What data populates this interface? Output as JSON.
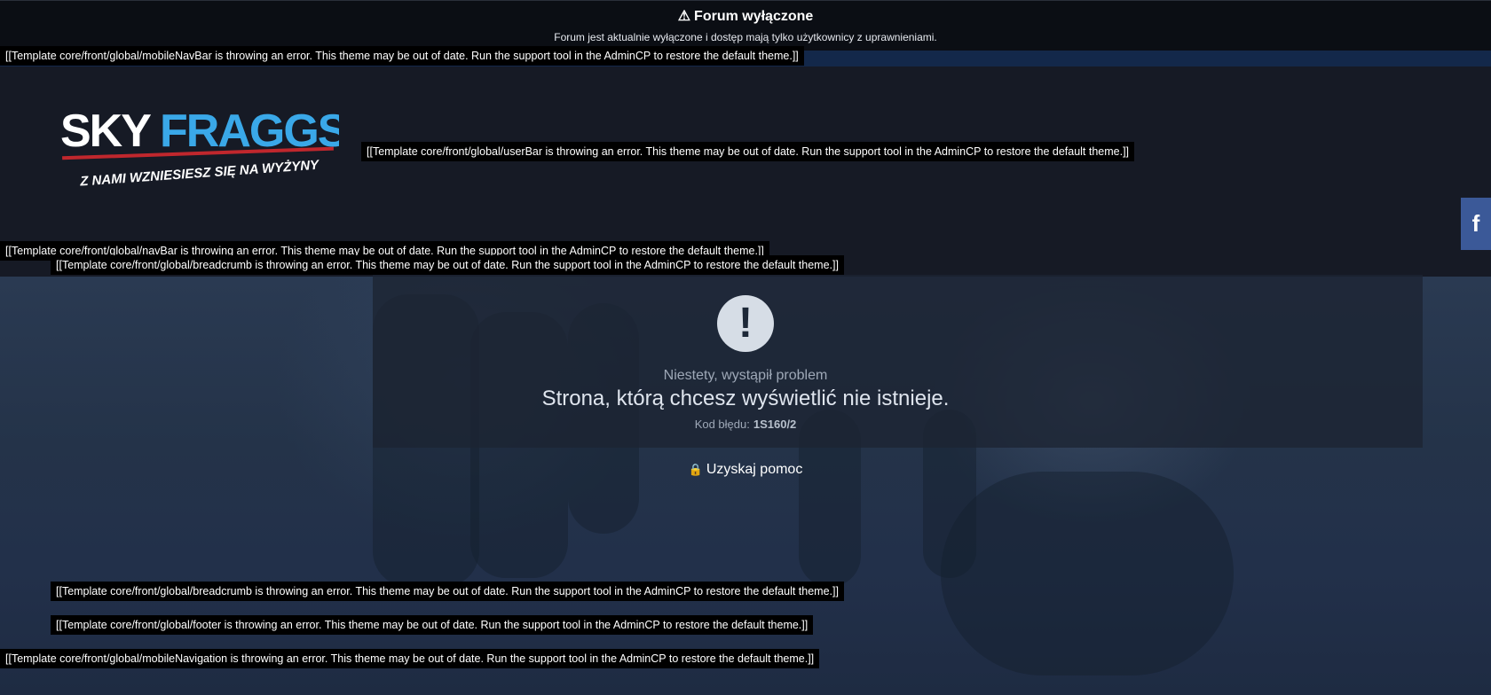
{
  "offline": {
    "icon": "warning-icon",
    "title": "Forum wyłączone",
    "message": "Forum jest aktualnie wyłączone i dostęp mają tylko użytkownicy z uprawnieniami."
  },
  "template_errors": {
    "mobile_nav_bar": "[[Template core/front/global/mobileNavBar is throwing an error. This theme may be out of date. Run the support tool in the AdminCP to restore the default theme.]]",
    "user_bar": "[[Template core/front/global/userBar is throwing an error. This theme may be out of date. Run the support tool in the AdminCP to restore the default theme.]]",
    "nav_bar": "[[Template core/front/global/navBar is throwing an error. This theme may be out of date. Run the support tool in the AdminCP to restore the default theme.]]",
    "breadcrumb_top": "[[Template core/front/global/breadcrumb is throwing an error. This theme may be out of date. Run the support tool in the AdminCP to restore the default theme.]]",
    "breadcrumb_bottom": "[[Template core/front/global/breadcrumb is throwing an error. This theme may be out of date. Run the support tool in the AdminCP to restore the default theme.]]",
    "footer": "[[Template core/front/global/footer is throwing an error. This theme may be out of date. Run the support tool in the AdminCP to restore the default theme.]]",
    "mobile_navigation": "[[Template core/front/global/mobileNavigation is throwing an error. This theme may be out of date. Run the support tool in the AdminCP to restore the default theme.]]"
  },
  "logo": {
    "name_part1": "SKY",
    "name_part2": "FRAGGS",
    "tagline": "Z NAMI WZNIESIESZ SIĘ NA WYŻYNY"
  },
  "error": {
    "icon": "exclamation-icon",
    "subtitle": "Niestety, wystąpił problem",
    "message": "Strona, którą chcesz wyświetlić nie istnieje.",
    "code_label": "Kod błędu:",
    "code_value": "1S160/2"
  },
  "help": {
    "icon": "lock-icon",
    "label": "Uzyskaj pomoc"
  },
  "social": {
    "facebook_label": "f",
    "facebook_color": "#3b5998"
  },
  "colors": {
    "background": "#161a25",
    "top_bar": "#0b0e14",
    "accent_blue": "#3aa8e8",
    "accent_red": "#c0272d"
  }
}
